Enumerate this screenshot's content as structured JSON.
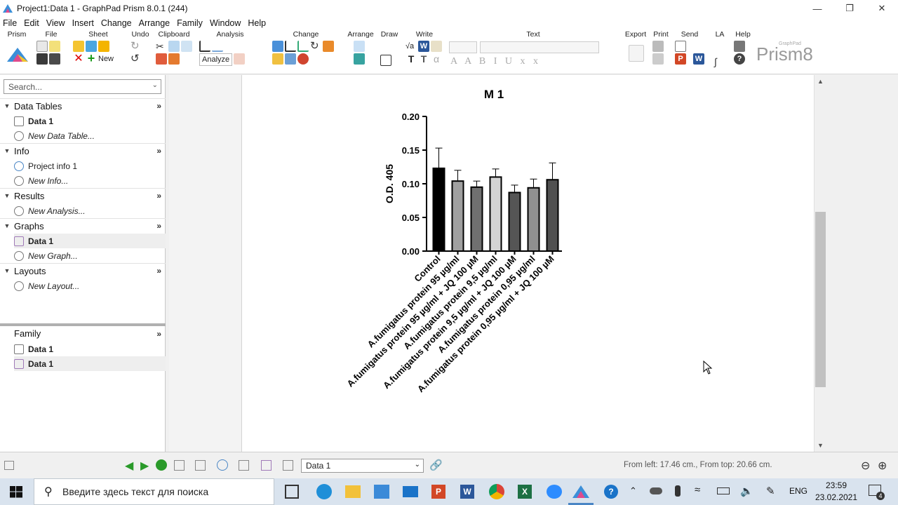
{
  "window": {
    "title": "Project1:Data 1 - GraphPad Prism 8.0.1 (244)",
    "controls": [
      "minimize-icon",
      "restore-icon",
      "close-icon"
    ]
  },
  "menu": [
    "File",
    "Edit",
    "View",
    "Insert",
    "Change",
    "Arrange",
    "Family",
    "Window",
    "Help"
  ],
  "ribbon": {
    "groups": [
      "Prism",
      "File",
      "Sheet",
      "Undo",
      "Clipboard",
      "Analysis",
      "Change",
      "Arrange",
      "Draw",
      "Write",
      "Text",
      "Export",
      "Print",
      "Send",
      "LA",
      "Help"
    ],
    "new_label": "New",
    "analyze_label": "Analyze",
    "logo_text": "Prism8",
    "logo_small": "GraphPad"
  },
  "sidebar": {
    "search_placeholder": "Search...",
    "sections": [
      {
        "label": "Data Tables",
        "items": [
          {
            "label": "Data 1",
            "bold": true
          },
          {
            "label": "New Data Table...",
            "italic": true
          }
        ]
      },
      {
        "label": "Info",
        "items": [
          {
            "label": "Project info 1"
          },
          {
            "label": "New Info...",
            "italic": true
          }
        ]
      },
      {
        "label": "Results",
        "items": [
          {
            "label": "New Analysis...",
            "italic": true
          }
        ]
      },
      {
        "label": "Graphs",
        "items": [
          {
            "label": "Data 1",
            "bold": true,
            "selected": true
          },
          {
            "label": "New Graph...",
            "italic": true
          }
        ]
      },
      {
        "label": "Layouts",
        "items": [
          {
            "label": "New Layout...",
            "italic": true
          }
        ]
      }
    ],
    "family": {
      "label": "Family",
      "items": [
        {
          "label": "Data 1",
          "bold": true
        },
        {
          "label": "Data 1",
          "bold": true,
          "selected": true
        }
      ]
    }
  },
  "statusbar": {
    "sheet_selected": "Data 1",
    "position_text": "From left: 17.46 cm., From top: 20.66 cm."
  },
  "taskbar": {
    "search_placeholder": "Введите здесь текст для поиска",
    "language": "ENG",
    "time": "23:59",
    "date": "23.02.2021",
    "notifications": "4"
  },
  "chart_data": {
    "type": "bar",
    "title": "M 1",
    "ylabel": "O.D. 405",
    "xlabel": "",
    "ylim": [
      0,
      0.2
    ],
    "yticks": [
      "0.00",
      "0.05",
      "0.10",
      "0.15",
      "0.20"
    ],
    "categories": [
      "Control",
      "A.fumigatus protein 95 µg/ml",
      "A.fumigatus protein 95 µg/ml + JQ 100 µM",
      "A.fumigatus protein 9,5 µg/ml",
      "A.fumigatus protein 9,5 µg/ml + JQ 100 µM",
      "A.fumigatus protein 0,95 µg/ml",
      "A.fumigatus protein 0,95 µg/ml + JQ 100 µM"
    ],
    "values": [
      0.123,
      0.104,
      0.095,
      0.11,
      0.087,
      0.094,
      0.106
    ],
    "errors": [
      0.03,
      0.016,
      0.009,
      0.012,
      0.011,
      0.013,
      0.025
    ],
    "colors": [
      "#000000",
      "#a0a0a0",
      "#707070",
      "#d3d3d3",
      "#555555",
      "#909090",
      "#505050"
    ]
  }
}
